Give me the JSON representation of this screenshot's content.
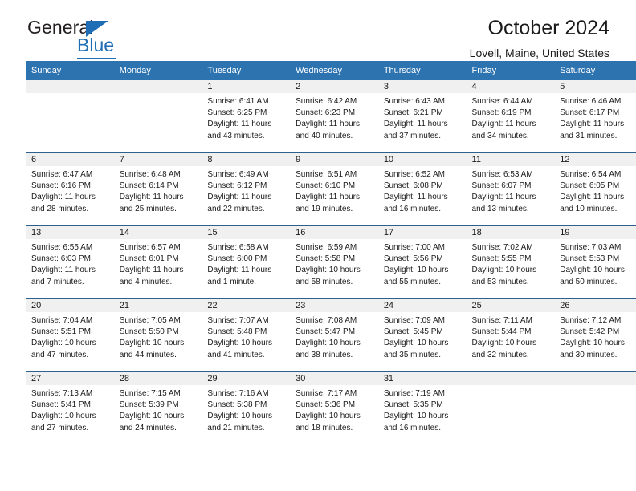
{
  "brand": {
    "name_top": "General",
    "name_bottom": "Blue",
    "accent_color": "#1f6eb5"
  },
  "header": {
    "title": "October 2024",
    "subtitle": "Lovell, Maine, United States"
  },
  "theme": {
    "header_blue": "#2d73b0",
    "row_divider": "#2f5f8f",
    "daynum_strip": "#f0f0f0"
  },
  "weekdays": [
    "Sunday",
    "Monday",
    "Tuesday",
    "Wednesday",
    "Thursday",
    "Friday",
    "Saturday"
  ],
  "weeks": [
    [
      {
        "day": "",
        "sunrise": "",
        "sunset": "",
        "daylight1": "",
        "daylight2": ""
      },
      {
        "day": "",
        "sunrise": "",
        "sunset": "",
        "daylight1": "",
        "daylight2": ""
      },
      {
        "day": "1",
        "sunrise": "Sunrise: 6:41 AM",
        "sunset": "Sunset: 6:25 PM",
        "daylight1": "Daylight: 11 hours",
        "daylight2": "and 43 minutes."
      },
      {
        "day": "2",
        "sunrise": "Sunrise: 6:42 AM",
        "sunset": "Sunset: 6:23 PM",
        "daylight1": "Daylight: 11 hours",
        "daylight2": "and 40 minutes."
      },
      {
        "day": "3",
        "sunrise": "Sunrise: 6:43 AM",
        "sunset": "Sunset: 6:21 PM",
        "daylight1": "Daylight: 11 hours",
        "daylight2": "and 37 minutes."
      },
      {
        "day": "4",
        "sunrise": "Sunrise: 6:44 AM",
        "sunset": "Sunset: 6:19 PM",
        "daylight1": "Daylight: 11 hours",
        "daylight2": "and 34 minutes."
      },
      {
        "day": "5",
        "sunrise": "Sunrise: 6:46 AM",
        "sunset": "Sunset: 6:17 PM",
        "daylight1": "Daylight: 11 hours",
        "daylight2": "and 31 minutes."
      }
    ],
    [
      {
        "day": "6",
        "sunrise": "Sunrise: 6:47 AM",
        "sunset": "Sunset: 6:16 PM",
        "daylight1": "Daylight: 11 hours",
        "daylight2": "and 28 minutes."
      },
      {
        "day": "7",
        "sunrise": "Sunrise: 6:48 AM",
        "sunset": "Sunset: 6:14 PM",
        "daylight1": "Daylight: 11 hours",
        "daylight2": "and 25 minutes."
      },
      {
        "day": "8",
        "sunrise": "Sunrise: 6:49 AM",
        "sunset": "Sunset: 6:12 PM",
        "daylight1": "Daylight: 11 hours",
        "daylight2": "and 22 minutes."
      },
      {
        "day": "9",
        "sunrise": "Sunrise: 6:51 AM",
        "sunset": "Sunset: 6:10 PM",
        "daylight1": "Daylight: 11 hours",
        "daylight2": "and 19 minutes."
      },
      {
        "day": "10",
        "sunrise": "Sunrise: 6:52 AM",
        "sunset": "Sunset: 6:08 PM",
        "daylight1": "Daylight: 11 hours",
        "daylight2": "and 16 minutes."
      },
      {
        "day": "11",
        "sunrise": "Sunrise: 6:53 AM",
        "sunset": "Sunset: 6:07 PM",
        "daylight1": "Daylight: 11 hours",
        "daylight2": "and 13 minutes."
      },
      {
        "day": "12",
        "sunrise": "Sunrise: 6:54 AM",
        "sunset": "Sunset: 6:05 PM",
        "daylight1": "Daylight: 11 hours",
        "daylight2": "and 10 minutes."
      }
    ],
    [
      {
        "day": "13",
        "sunrise": "Sunrise: 6:55 AM",
        "sunset": "Sunset: 6:03 PM",
        "daylight1": "Daylight: 11 hours",
        "daylight2": "and 7 minutes."
      },
      {
        "day": "14",
        "sunrise": "Sunrise: 6:57 AM",
        "sunset": "Sunset: 6:01 PM",
        "daylight1": "Daylight: 11 hours",
        "daylight2": "and 4 minutes."
      },
      {
        "day": "15",
        "sunrise": "Sunrise: 6:58 AM",
        "sunset": "Sunset: 6:00 PM",
        "daylight1": "Daylight: 11 hours",
        "daylight2": "and 1 minute."
      },
      {
        "day": "16",
        "sunrise": "Sunrise: 6:59 AM",
        "sunset": "Sunset: 5:58 PM",
        "daylight1": "Daylight: 10 hours",
        "daylight2": "and 58 minutes."
      },
      {
        "day": "17",
        "sunrise": "Sunrise: 7:00 AM",
        "sunset": "Sunset: 5:56 PM",
        "daylight1": "Daylight: 10 hours",
        "daylight2": "and 55 minutes."
      },
      {
        "day": "18",
        "sunrise": "Sunrise: 7:02 AM",
        "sunset": "Sunset: 5:55 PM",
        "daylight1": "Daylight: 10 hours",
        "daylight2": "and 53 minutes."
      },
      {
        "day": "19",
        "sunrise": "Sunrise: 7:03 AM",
        "sunset": "Sunset: 5:53 PM",
        "daylight1": "Daylight: 10 hours",
        "daylight2": "and 50 minutes."
      }
    ],
    [
      {
        "day": "20",
        "sunrise": "Sunrise: 7:04 AM",
        "sunset": "Sunset: 5:51 PM",
        "daylight1": "Daylight: 10 hours",
        "daylight2": "and 47 minutes."
      },
      {
        "day": "21",
        "sunrise": "Sunrise: 7:05 AM",
        "sunset": "Sunset: 5:50 PM",
        "daylight1": "Daylight: 10 hours",
        "daylight2": "and 44 minutes."
      },
      {
        "day": "22",
        "sunrise": "Sunrise: 7:07 AM",
        "sunset": "Sunset: 5:48 PM",
        "daylight1": "Daylight: 10 hours",
        "daylight2": "and 41 minutes."
      },
      {
        "day": "23",
        "sunrise": "Sunrise: 7:08 AM",
        "sunset": "Sunset: 5:47 PM",
        "daylight1": "Daylight: 10 hours",
        "daylight2": "and 38 minutes."
      },
      {
        "day": "24",
        "sunrise": "Sunrise: 7:09 AM",
        "sunset": "Sunset: 5:45 PM",
        "daylight1": "Daylight: 10 hours",
        "daylight2": "and 35 minutes."
      },
      {
        "day": "25",
        "sunrise": "Sunrise: 7:11 AM",
        "sunset": "Sunset: 5:44 PM",
        "daylight1": "Daylight: 10 hours",
        "daylight2": "and 32 minutes."
      },
      {
        "day": "26",
        "sunrise": "Sunrise: 7:12 AM",
        "sunset": "Sunset: 5:42 PM",
        "daylight1": "Daylight: 10 hours",
        "daylight2": "and 30 minutes."
      }
    ],
    [
      {
        "day": "27",
        "sunrise": "Sunrise: 7:13 AM",
        "sunset": "Sunset: 5:41 PM",
        "daylight1": "Daylight: 10 hours",
        "daylight2": "and 27 minutes."
      },
      {
        "day": "28",
        "sunrise": "Sunrise: 7:15 AM",
        "sunset": "Sunset: 5:39 PM",
        "daylight1": "Daylight: 10 hours",
        "daylight2": "and 24 minutes."
      },
      {
        "day": "29",
        "sunrise": "Sunrise: 7:16 AM",
        "sunset": "Sunset: 5:38 PM",
        "daylight1": "Daylight: 10 hours",
        "daylight2": "and 21 minutes."
      },
      {
        "day": "30",
        "sunrise": "Sunrise: 7:17 AM",
        "sunset": "Sunset: 5:36 PM",
        "daylight1": "Daylight: 10 hours",
        "daylight2": "and 18 minutes."
      },
      {
        "day": "31",
        "sunrise": "Sunrise: 7:19 AM",
        "sunset": "Sunset: 5:35 PM",
        "daylight1": "Daylight: 10 hours",
        "daylight2": "and 16 minutes."
      },
      {
        "day": "",
        "sunrise": "",
        "sunset": "",
        "daylight1": "",
        "daylight2": ""
      },
      {
        "day": "",
        "sunrise": "",
        "sunset": "",
        "daylight1": "",
        "daylight2": ""
      }
    ]
  ]
}
